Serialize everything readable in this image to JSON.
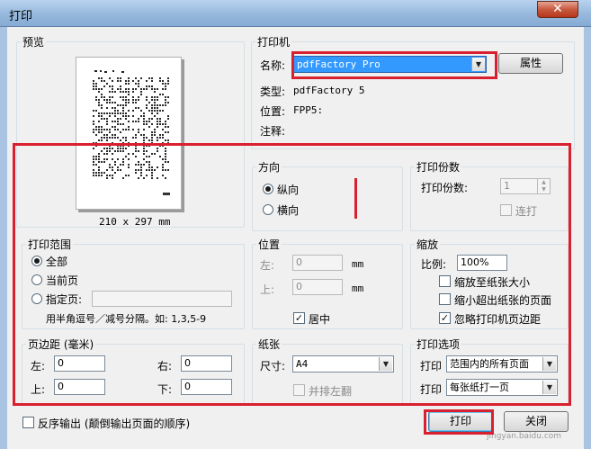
{
  "window": {
    "title": "打印",
    "close_glyph": "✕"
  },
  "preview": {
    "group_label": "预览",
    "paper_size": "210 x 297 mm"
  },
  "printer": {
    "group_label": "打印机",
    "name_label": "名称:",
    "name_value": "pdfFactory Pro",
    "properties_button": "属性",
    "type_label": "类型:",
    "type_value": "pdfFactory 5",
    "location_label": "位置:",
    "location_value": "FPP5:",
    "comment_label": "注释:"
  },
  "orientation": {
    "group_label": "方向",
    "portrait": "纵向",
    "landscape": "横向",
    "selected": "portrait"
  },
  "copies": {
    "group_label": "打印份数",
    "count_label": "打印份数:",
    "count_value": "1",
    "collate_label": "连打"
  },
  "print_range": {
    "group_label": "打印范围",
    "all": "全部",
    "current_page": "当前页",
    "specified_pages": "指定页:",
    "hint": "用半角逗号／减号分隔。如: 1,3,5-9",
    "selected": "all"
  },
  "position": {
    "group_label": "位置",
    "left_label": "左:",
    "left_value": "0",
    "top_label": "上:",
    "top_value": "0",
    "unit": "mm",
    "center_label": "居中",
    "center_checked": true
  },
  "scaling": {
    "group_label": "缩放",
    "ratio_label": "比例:",
    "ratio_value": "100%",
    "fit_paper": "缩放至纸张大小",
    "shrink_oversize": "缩小超出纸张的页面",
    "ignore_margins": "忽略打印机页边距",
    "fit_paper_checked": false,
    "shrink_checked": false,
    "ignore_margins_checked": true
  },
  "margins": {
    "group_label": "页边距 (毫米)",
    "left_label": "左:",
    "left_value": "0",
    "right_label": "右:",
    "right_value": "0",
    "top_label": "上:",
    "top_value": "0",
    "bottom_label": "下:",
    "bottom_value": "0"
  },
  "paper": {
    "group_label": "纸张",
    "size_label": "尺寸:",
    "size_value": "A4",
    "duplex_label": "并排左翻"
  },
  "print_options": {
    "group_label": "打印选项",
    "print_label_1": "打印",
    "print_value_1": "范围内的所有页面",
    "print_label_2": "打印",
    "print_value_2": "每张纸打一页"
  },
  "footer": {
    "reverse_label": "反序输出 (颠倒输出页面的顺序)",
    "print_button": "打印",
    "close_button": "关闭"
  },
  "watermark": "jingyan.baidu.com",
  "colors": {
    "highlight_red": "#d8202e",
    "selection_blue": "#3399ff",
    "dialog_bg": "#f0f0f0"
  }
}
